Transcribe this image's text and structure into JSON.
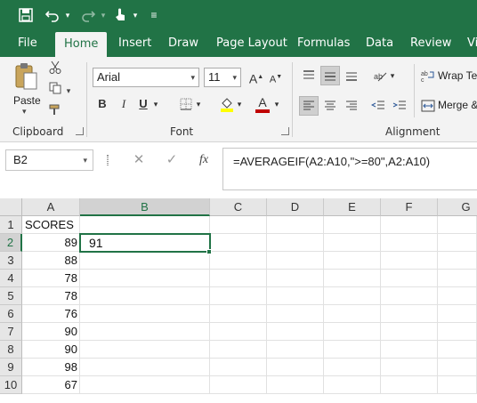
{
  "qat": {
    "save_icon": "save-icon",
    "undo_icon": "undo-icon",
    "redo_icon": "redo-icon",
    "touch_icon": "touch-mode-icon",
    "customize_icon": "customize-qat-icon"
  },
  "tabs": [
    "File",
    "Home",
    "Insert",
    "Draw",
    "Page Layout",
    "Formulas",
    "Data",
    "Review",
    "Vi"
  ],
  "ribbon": {
    "paste_label": "Paste",
    "clipboard_label": "Clipboard",
    "font_name": "Arial",
    "font_size": "11",
    "font_label": "Font",
    "alignment_label": "Alignment",
    "wrap_text": "Wrap Tex",
    "merge": "Merge &",
    "bold": "B",
    "italic": "I",
    "underline": "U",
    "grow_font": "A",
    "shrink_font": "A",
    "font_color_letter": "A",
    "font_color": "#c00000",
    "highlight_color": "#ffff00"
  },
  "formula_bar": {
    "name_box": "B2",
    "formula": "=AVERAGEIF(A2:A10,\">=80\",A2:A10)",
    "fx": "fx"
  },
  "grid": {
    "columns": [
      "A",
      "B",
      "C",
      "D",
      "E",
      "F",
      "G"
    ],
    "rows": [
      "1",
      "2",
      "3",
      "4",
      "5",
      "6",
      "7",
      "8",
      "9",
      "10"
    ],
    "a1": "SCORES",
    "a_values": [
      "89",
      "88",
      "78",
      "78",
      "76",
      "90",
      "90",
      "98",
      "67"
    ],
    "b2": "91"
  },
  "colors": {
    "accent": "#217346"
  }
}
